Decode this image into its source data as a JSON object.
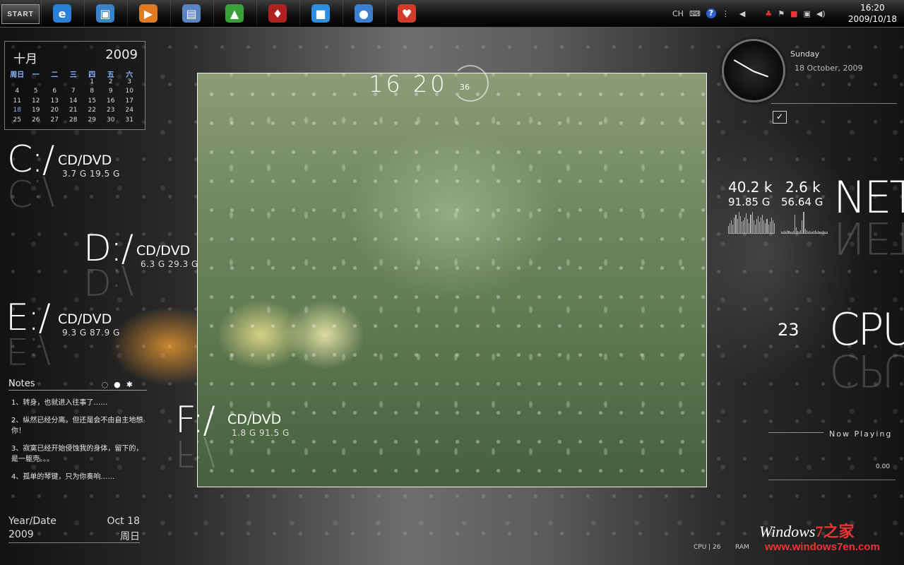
{
  "taskbar": {
    "start_label": "START",
    "apps": [
      {
        "name": "ie-icon",
        "glyph": "e",
        "color": "#2a7fd8"
      },
      {
        "name": "store-icon",
        "glyph": "▣",
        "color": "#3b82c8"
      },
      {
        "name": "media-player-icon",
        "glyph": "▶",
        "color": "#e07a20"
      },
      {
        "name": "window-switch-icon",
        "glyph": "▤",
        "color": "#5b84c4"
      },
      {
        "name": "monitor-graph-icon",
        "glyph": "▲",
        "color": "#3aa03a"
      },
      {
        "name": "game-mask-icon",
        "glyph": "♦",
        "color": "#b02020"
      },
      {
        "name": "folders-icon",
        "glyph": "■",
        "color": "#2d8ee0"
      },
      {
        "name": "globe-icon",
        "glyph": "●",
        "color": "#3b7fd0"
      },
      {
        "name": "qq-penguin-icon",
        "glyph": "♥",
        "color": "#d23a2a"
      }
    ],
    "tray": {
      "lang": "CH",
      "clock_time": "16:20",
      "clock_date": "2009/10/18"
    }
  },
  "calendar": {
    "month": "十月",
    "year": "2009",
    "weekdays": [
      "周日",
      "一",
      "二",
      "三",
      "四",
      "五",
      "六"
    ],
    "weeks": [
      [
        "",
        "",
        "",
        "",
        "1",
        "2",
        "3"
      ],
      [
        "4",
        "5",
        "6",
        "7",
        "8",
        "9",
        "10"
      ],
      [
        "11",
        "12",
        "13",
        "14",
        "15",
        "16",
        "17"
      ],
      [
        "18",
        "19",
        "20",
        "21",
        "22",
        "23",
        "24"
      ],
      [
        "25",
        "26",
        "27",
        "28",
        "29",
        "30",
        "31"
      ]
    ],
    "today": "18"
  },
  "drives": [
    {
      "letter": "C:/",
      "type": "CD/DVD",
      "size": "3.7 G 19.5 G"
    },
    {
      "letter": "D:/",
      "type": "CD/DVD",
      "size": "6.3 G 29.3 G"
    },
    {
      "letter": "E:/",
      "type": "CD/DVD",
      "size": "9.3 G 87.9 G"
    },
    {
      "letter": "F:/",
      "type": "CD/DVD",
      "size": "1.8 G 91.5 G"
    }
  ],
  "notes": {
    "title": "Notes",
    "items": [
      "1、转身，也就进入往事了……",
      "2、纵然已经分离，但还是会不由自主地想你！",
      "3、寂寞已经开始侵蚀我的身体，留下的，是一躯壳。。。",
      "4、孤单的琴键，只为你奏响……"
    ]
  },
  "yeardate": {
    "label": "Year/Date",
    "date": "Oct 18",
    "year": "2009",
    "weekday": "周日"
  },
  "big_clock": {
    "time": "16 20",
    "seconds": "36"
  },
  "analog_clock": {
    "day": "Sunday",
    "date": "18 October, 2009"
  },
  "net": {
    "word": "NET",
    "down_rate": "40.2 k",
    "down_total": "91.85 G",
    "up_rate": "2.6 k",
    "up_total": "56.64 G"
  },
  "cpu": {
    "word": "CPU",
    "value": "23"
  },
  "now_playing": {
    "title": "Now Playing",
    "time": "0.00"
  },
  "bottom": {
    "cpu_label": "CPU | 26",
    "ram_label": "RAM"
  },
  "watermark": {
    "prefix": "Windows",
    "seven": "7",
    "suffix": "之家",
    "url": "www.windows7en.com"
  }
}
